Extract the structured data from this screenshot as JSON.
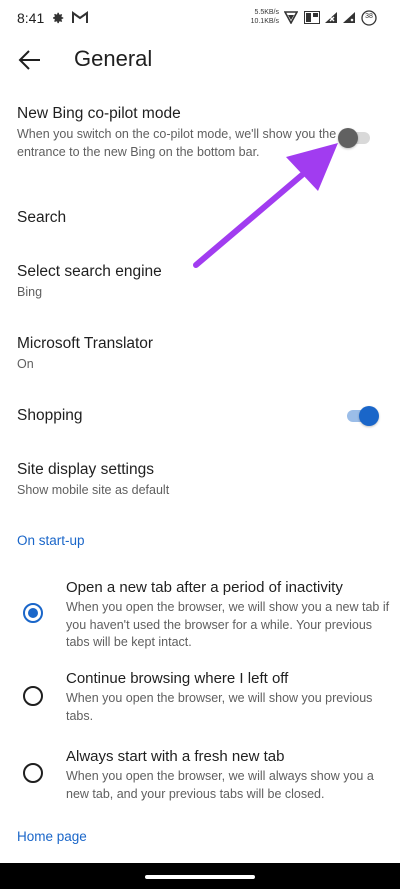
{
  "status": {
    "time": "8:41",
    "speed_up": "5.5KB/s",
    "speed_down": "10.1KB/s",
    "battery": "38"
  },
  "header": {
    "title": "General"
  },
  "settings": {
    "copilot": {
      "label": "New Bing co-pilot mode",
      "desc": "When you switch on the co-pilot mode, we'll show you the entrance to the new Bing on the bottom bar.",
      "enabled": false
    },
    "search": {
      "label": "Search"
    },
    "engine": {
      "label": "Select search engine",
      "value": "Bing"
    },
    "translator": {
      "label": "Microsoft Translator",
      "value": "On"
    },
    "shopping": {
      "label": "Shopping",
      "enabled": true
    },
    "site_display": {
      "label": "Site display settings",
      "value": "Show mobile site as default"
    }
  },
  "startup": {
    "heading": "On start-up",
    "options": [
      {
        "title": "Open a new tab after a period of inactivity",
        "desc": "When you open the browser, we will show you a new tab if you haven't used the browser for a while. Your previous tabs will be kept intact.",
        "selected": true
      },
      {
        "title": "Continue browsing where I left off",
        "desc": "When you open the browser, we will show you previous tabs.",
        "selected": false
      },
      {
        "title": "Always start with a fresh new tab",
        "desc": "When you open the browser, we will always show you a new tab, and your previous tabs will be closed.",
        "selected": false
      }
    ]
  },
  "homepage": {
    "heading": "Home page"
  },
  "colors": {
    "accent": "#1a66c9",
    "annotation_arrow": "#a13cf0",
    "toggle_off_thumb": "#616161",
    "toggle_off_track": "#d9d9d9"
  },
  "icons": [
    "settings-gear-icon",
    "gmail-icon",
    "signal-icon",
    "volte-icon",
    "signal-crossed-icon",
    "wifi-icon",
    "battery-icon",
    "back-arrow-icon"
  ]
}
